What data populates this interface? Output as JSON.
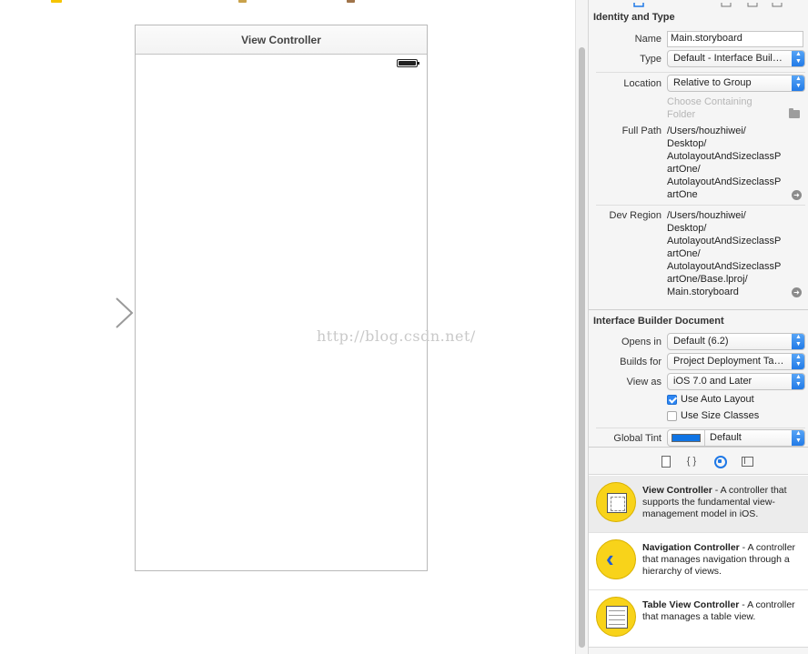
{
  "canvas": {
    "scene_title": "View Controller",
    "watermark": "http://blog.csdn.net/"
  },
  "inspector": {
    "identity_and_type": {
      "header": "Identity and Type",
      "name_label": "Name",
      "name_value": "Main.storyboard",
      "type_label": "Type",
      "type_value": "Default - Interface Builder Storyboard",
      "location_label": "Location",
      "location_value": "Relative to Group",
      "choose_folder_line1": "Choose Containing",
      "choose_folder_line2": "Folder",
      "full_path_label": "Full Path",
      "full_path_lines": [
        "/Users/houzhiwei/",
        "Desktop/",
        "AutolayoutAndSizeclassP",
        "artOne/",
        "AutolayoutAndSizeclassP",
        "artOne"
      ],
      "dev_region_label": "Dev Region",
      "dev_region_lines": [
        "/Users/houzhiwei/",
        "Desktop/",
        "AutolayoutAndSizeclassP",
        "artOne/",
        "AutolayoutAndSizeclassP",
        "artOne/Base.lproj/",
        "Main.storyboard"
      ]
    },
    "ib_document": {
      "header": "Interface Builder Document",
      "opens_in_label": "Opens in",
      "opens_in_value": "Default (6.2)",
      "builds_for_label": "Builds for",
      "builds_for_value": "Project Deployment Target",
      "view_as_label": "View as",
      "view_as_value": "iOS 7.0 and Later",
      "use_auto_layout_label": "Use Auto Layout",
      "use_auto_layout_checked": true,
      "use_size_classes_label": "Use Size Classes",
      "use_size_classes_checked": false,
      "global_tint_label": "Global Tint",
      "global_tint_value": "Default",
      "global_tint_color": "#0f74e4"
    },
    "library": {
      "tabs": [
        "file-template-icon",
        "code-snippet-icon",
        "object-library-icon",
        "media-library-icon"
      ],
      "active_tab": "object-library-icon",
      "items": [
        {
          "name": "View Controller",
          "description": " - A controller that supports the fundamental view-management model in iOS.",
          "icon": "view-controller-icon"
        },
        {
          "name": "Navigation Controller",
          "description": " - A controller that manages navigation through a hierarchy of views.",
          "icon": "navigation-controller-icon"
        },
        {
          "name": "Table View Controller",
          "description": " - A controller that manages a table view.",
          "icon": "table-view-controller-icon"
        }
      ]
    }
  }
}
